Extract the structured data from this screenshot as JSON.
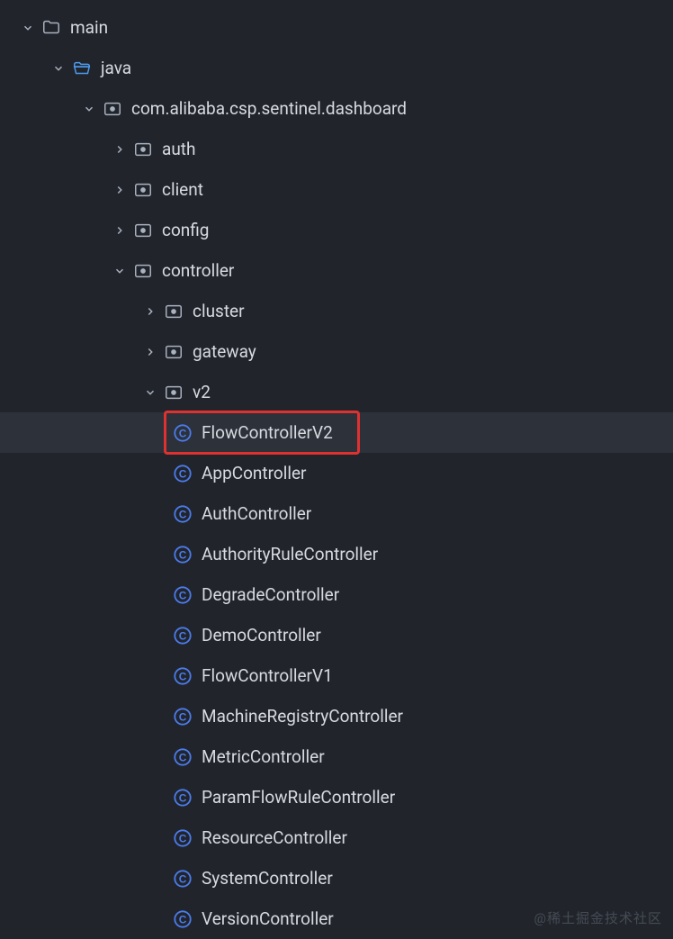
{
  "watermark": "@稀土掘金技术社区",
  "tree": [
    {
      "depth": 0,
      "arrow": "down",
      "icon": "folder",
      "label": "main"
    },
    {
      "depth": 1,
      "arrow": "down",
      "icon": "folder-open",
      "label": "java"
    },
    {
      "depth": 2,
      "arrow": "down",
      "icon": "package",
      "label": "com.alibaba.csp.sentinel.dashboard"
    },
    {
      "depth": 3,
      "arrow": "right",
      "icon": "package",
      "label": "auth"
    },
    {
      "depth": 3,
      "arrow": "right",
      "icon": "package",
      "label": "client"
    },
    {
      "depth": 3,
      "arrow": "right",
      "icon": "package",
      "label": "config"
    },
    {
      "depth": 3,
      "arrow": "down",
      "icon": "package",
      "label": "controller"
    },
    {
      "depth": 4,
      "arrow": "right",
      "icon": "package",
      "label": "cluster"
    },
    {
      "depth": 4,
      "arrow": "right",
      "icon": "package",
      "label": "gateway"
    },
    {
      "depth": 4,
      "arrow": "down",
      "icon": "package",
      "label": "v2"
    },
    {
      "depth": 5,
      "arrow": "none",
      "icon": "class",
      "label": "FlowControllerV2",
      "selected": true,
      "boxed": true
    },
    {
      "depth": 5,
      "arrow": "none",
      "icon": "class",
      "label": "AppController"
    },
    {
      "depth": 5,
      "arrow": "none",
      "icon": "class",
      "label": "AuthController"
    },
    {
      "depth": 5,
      "arrow": "none",
      "icon": "class",
      "label": "AuthorityRuleController"
    },
    {
      "depth": 5,
      "arrow": "none",
      "icon": "class",
      "label": "DegradeController"
    },
    {
      "depth": 5,
      "arrow": "none",
      "icon": "class",
      "label": "DemoController"
    },
    {
      "depth": 5,
      "arrow": "none",
      "icon": "class",
      "label": "FlowControllerV1"
    },
    {
      "depth": 5,
      "arrow": "none",
      "icon": "class",
      "label": "MachineRegistryController"
    },
    {
      "depth": 5,
      "arrow": "none",
      "icon": "class",
      "label": "MetricController"
    },
    {
      "depth": 5,
      "arrow": "none",
      "icon": "class",
      "label": "ParamFlowRuleController"
    },
    {
      "depth": 5,
      "arrow": "none",
      "icon": "class",
      "label": "ResourceController"
    },
    {
      "depth": 5,
      "arrow": "none",
      "icon": "class",
      "label": "SystemController"
    },
    {
      "depth": 5,
      "arrow": "none",
      "icon": "class",
      "label": "VersionController"
    }
  ]
}
